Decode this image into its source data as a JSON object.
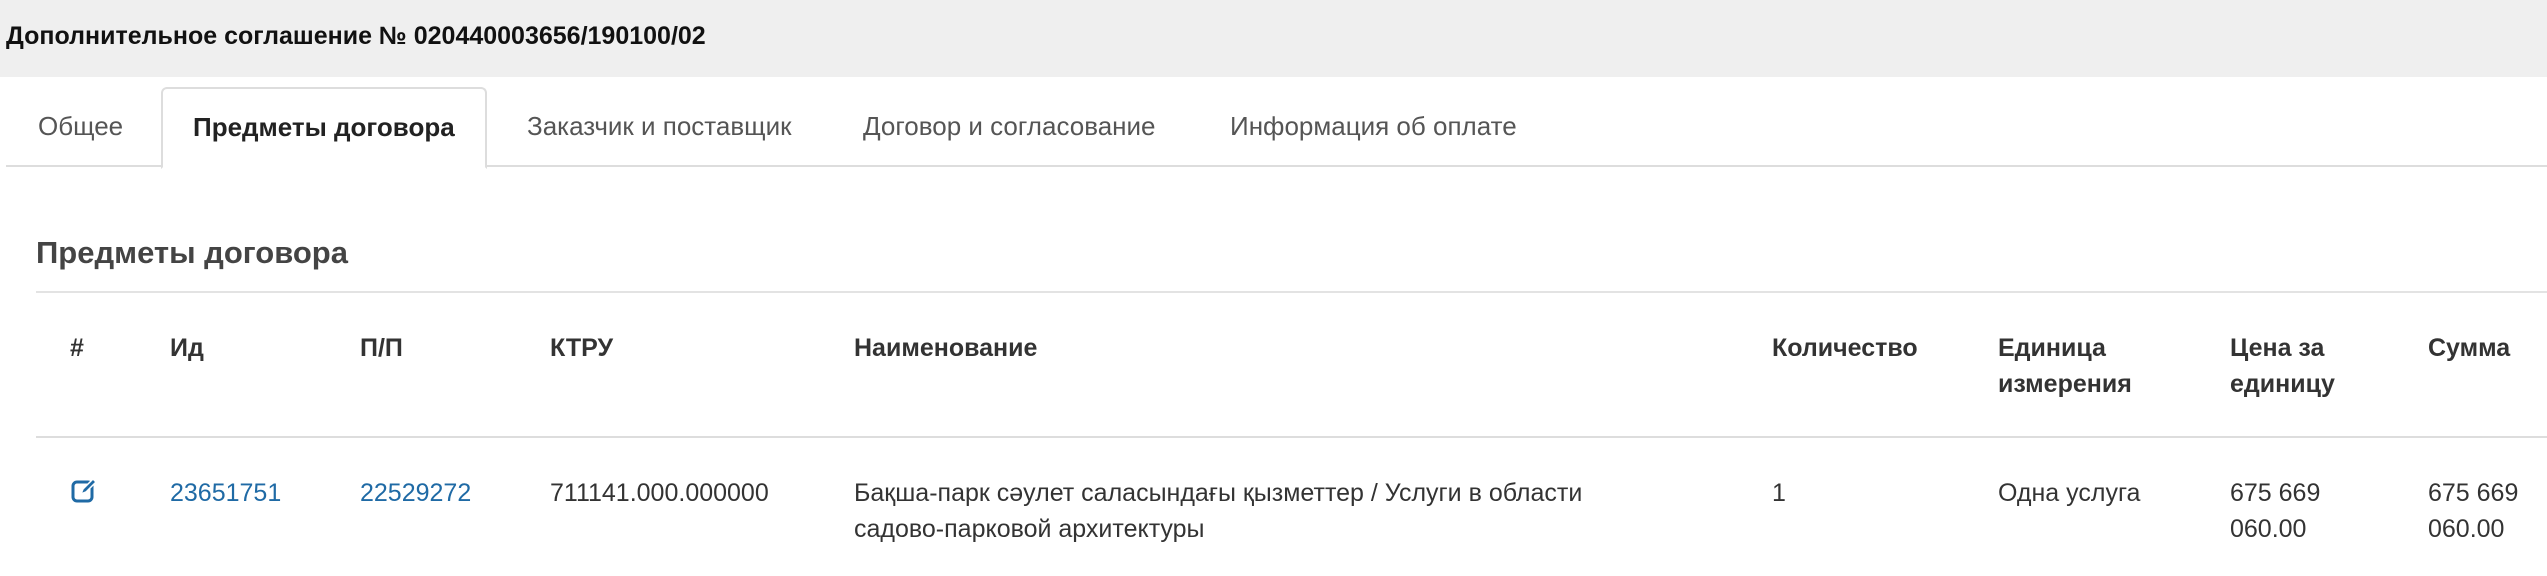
{
  "header": {
    "title": "Дополнительное соглашение № 020440003656/190100/02"
  },
  "tabs": [
    {
      "label": "Общее",
      "active": false
    },
    {
      "label": "Предметы договора",
      "active": true
    },
    {
      "label": "Заказчик и поставщик",
      "active": false
    },
    {
      "label": "Договор и согласование",
      "active": false
    },
    {
      "label": "Информация об оплате",
      "active": false
    }
  ],
  "section": {
    "title": "Предметы договора"
  },
  "table": {
    "columns": [
      {
        "label": "#"
      },
      {
        "label": "Ид"
      },
      {
        "label": "П/П"
      },
      {
        "label": "КТРУ"
      },
      {
        "label": "Наименование"
      },
      {
        "label": "Количество"
      },
      {
        "label": "Единица измерения"
      },
      {
        "label": "Цена за единицу"
      },
      {
        "label": "Сумма"
      }
    ],
    "rows": [
      {
        "icon": "edit-icon",
        "id": "23651751",
        "pp": "22529272",
        "ktru": "711141.000.000000",
        "name": "Бақша-парк сәулет саласындағы қызметтер / Услуги в области садово-парковой архитектуры",
        "quantity": "1",
        "unit": "Одна услуга",
        "price": "675 669 060.00",
        "sum": "675 669 060.00"
      }
    ]
  },
  "colors": {
    "link": "#1f6aa5",
    "topbar_bg": "#efefef",
    "border": "#dddddd"
  }
}
